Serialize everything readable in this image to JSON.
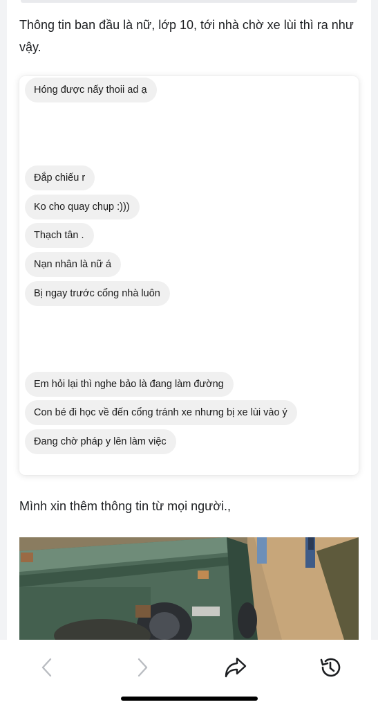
{
  "article": {
    "intro_text": "Thông tin ban đầu là nữ, lớp 10, tới nhà chờ xe lùi thì ra như vậy.",
    "chat_messages": [
      "Hóng được nấy thoii ad ạ",
      "Đắp chiếu r",
      "Ko cho quay chụp :)))",
      "Thạch tân .",
      "Nạn nhân là nữ á",
      "Bị ngay trước cổng nhà luôn",
      "Em hỏi lại thì nghe bảo là đang làm đường",
      "Con bé đi học về đến cổng tránh xe nhưng bị xe lùi vào ý",
      "Đang chờ pháp y lên làm việc"
    ],
    "follow_text": "Mình xin thêm thông tin từ mọi người.,",
    "photo_subject": "green dump truck reversing on a dirt road with people standing nearby"
  },
  "toolbar": {
    "back_icon": "chevron-left-icon",
    "forward_icon": "chevron-right-icon",
    "share_icon": "share-arrow-icon",
    "history_icon": "history-clock-icon",
    "active_color": "#1c1e21",
    "disabled_color": "#b9bcc1"
  }
}
